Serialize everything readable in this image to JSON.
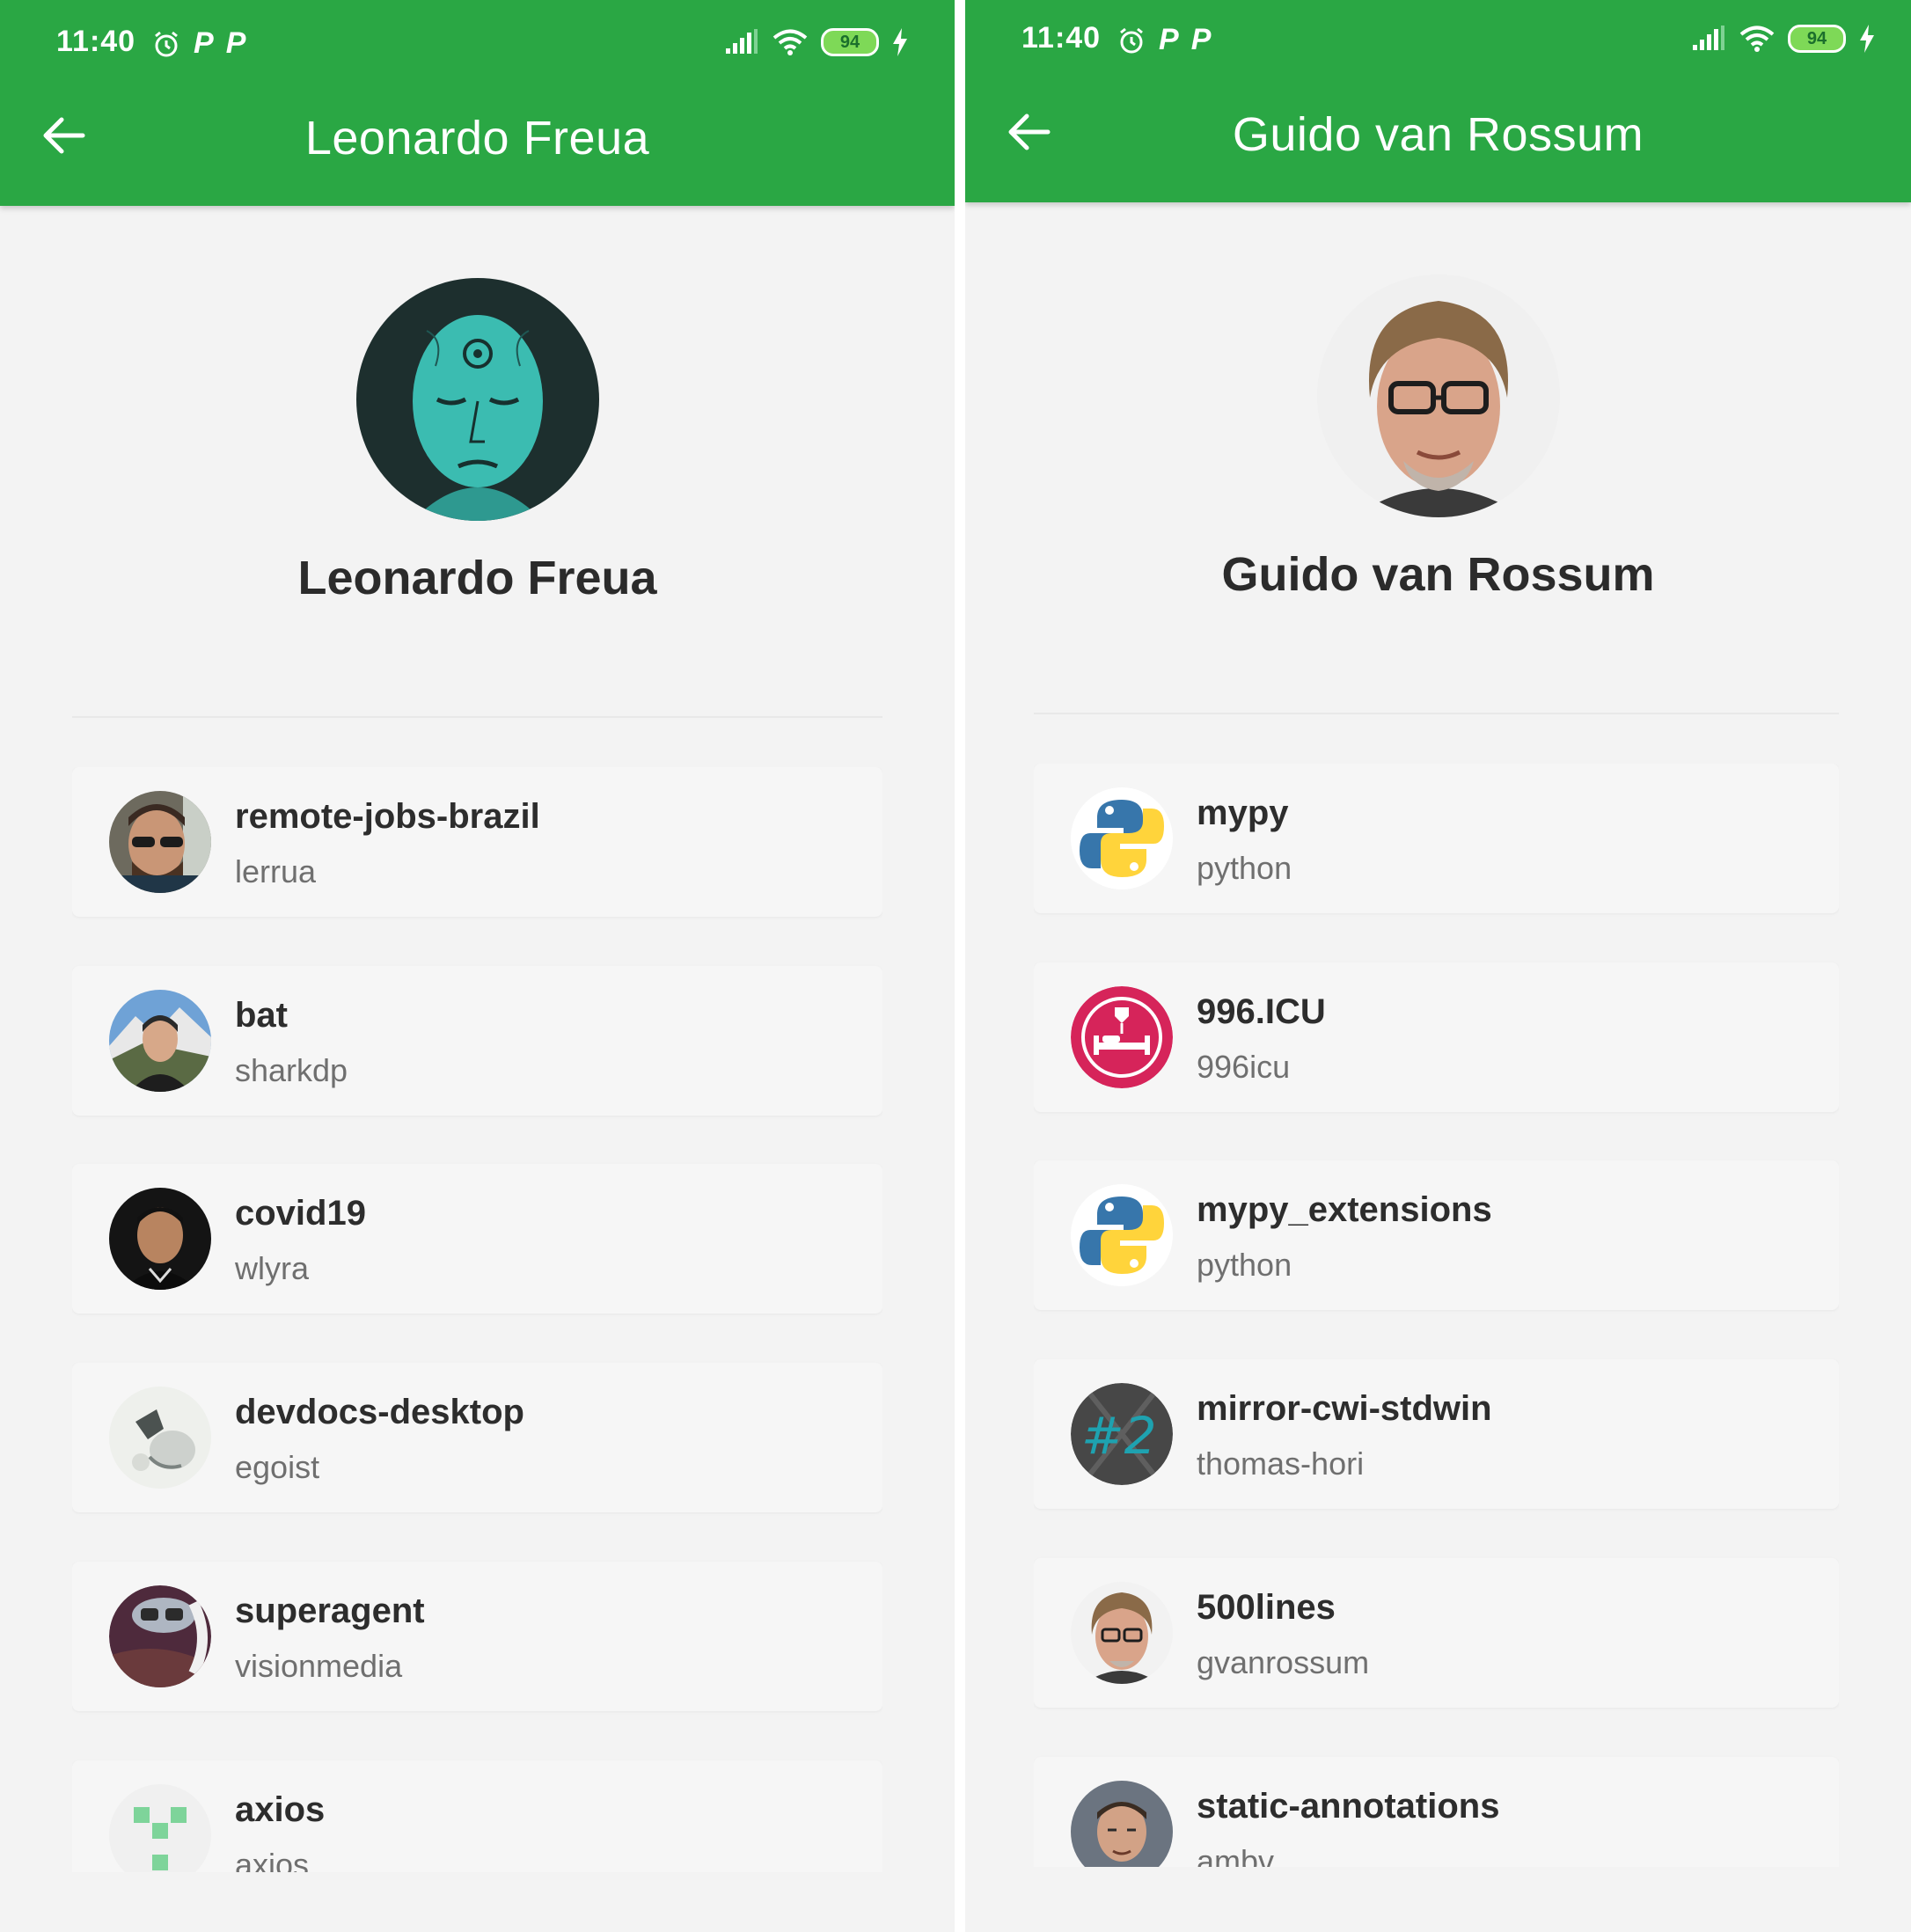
{
  "status_bar": {
    "time": "11:40",
    "battery": "94"
  },
  "colors": {
    "header": "#2aa744",
    "background": "#f3f3f3",
    "card": "#f6f6f6"
  },
  "left": {
    "title": "Leonardo Freua",
    "profile_name": "Leonardo Freua",
    "repos": [
      {
        "name": "remote-jobs-brazil",
        "owner": "lerrua"
      },
      {
        "name": "bat",
        "owner": "sharkdp"
      },
      {
        "name": "covid19",
        "owner": "wlyra"
      },
      {
        "name": "devdocs-desktop",
        "owner": "egoist"
      },
      {
        "name": "superagent",
        "owner": "visionmedia"
      },
      {
        "name": "axios",
        "owner": "axios"
      }
    ]
  },
  "right": {
    "title": "Guido van Rossum",
    "profile_name": "Guido van Rossum",
    "repos": [
      {
        "name": "mypy",
        "owner": "python"
      },
      {
        "name": "996.ICU",
        "owner": "996icu"
      },
      {
        "name": "mypy_extensions",
        "owner": "python"
      },
      {
        "name": "mirror-cwi-stdwin",
        "owner": "thomas-hori"
      },
      {
        "name": "500lines",
        "owner": "gvanrossum"
      },
      {
        "name": "static-annotations",
        "owner": "ambv"
      }
    ]
  },
  "icons": {
    "back": "arrow-left-icon",
    "alarm": "alarm-icon",
    "signal": "signal-icon",
    "wifi": "wifi-icon",
    "charging": "bolt-icon"
  }
}
